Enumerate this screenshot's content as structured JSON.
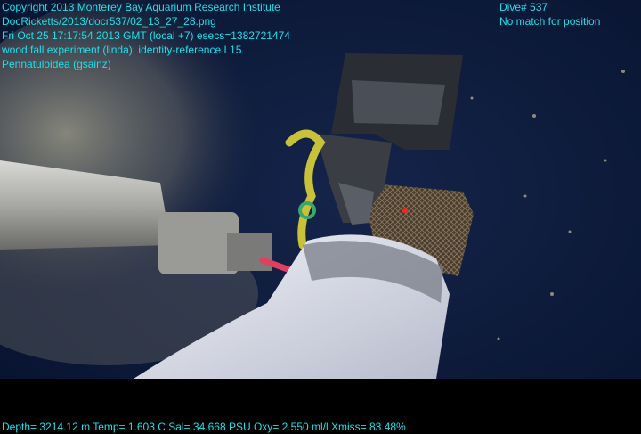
{
  "overlay": {
    "left_lines": [
      "Copyright 2013 Monterey Bay Aquarium Research Institute",
      "DocRicketts/2013/docr537/02_13_27_28.png",
      "Fri Oct 25 17:17:54 2013 GMT (local +7)  esecs=1382721474",
      "wood fall experiment (linda): identity-reference L15",
      "Pennatuloidea (gsainz)"
    ],
    "right_lines": [
      "Dive# 537",
      "No match for position"
    ],
    "bottom_line": "Depth= 3214.12 m  Temp= 1.603 C  Sal= 34.668 PSU  Oxy= 2.550 ml/l  Xmiss= 83.48%"
  },
  "colors": {
    "overlay_text": "#19e0ea",
    "water": "#0c1a3a",
    "sediment_plume": "#8a8878",
    "sampling_bag": "#e2e6f0",
    "rope": "#c8c23a",
    "net_bag": "#6b5a42",
    "laser_dot": "#ff2020"
  }
}
